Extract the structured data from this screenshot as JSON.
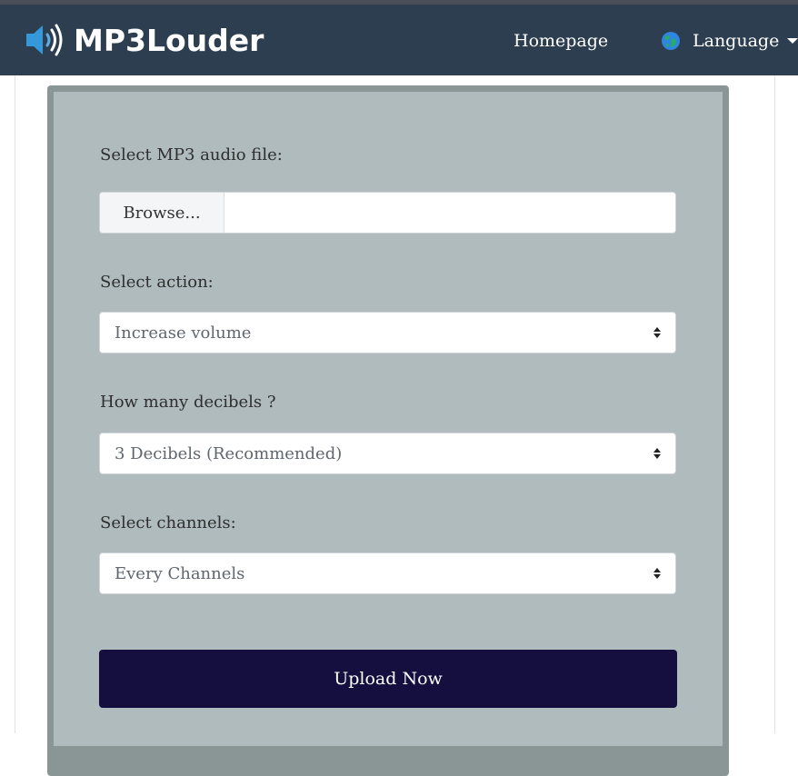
{
  "header": {
    "brand_name": "MP3Louder",
    "brand_icon": "speaker-volume-icon",
    "nav": {
      "homepage": "Homepage",
      "language": "Language"
    },
    "colors": {
      "navbar_bg": "#2c3e50",
      "brand_icon": "#3498db"
    }
  },
  "form": {
    "file": {
      "label": "Select MP3 audio file:",
      "browse_label": "Browse..."
    },
    "action": {
      "label": "Select action:",
      "selected": "Increase volume"
    },
    "decibels": {
      "label": "How many decibels ?",
      "selected": "3 Decibels (Recommended)"
    },
    "channels": {
      "label": "Select channels:",
      "selected": "Every Channels"
    },
    "submit_label": "Upload Now",
    "colors": {
      "panel_border": "#8a9596",
      "panel_bg": "#b0bbbd",
      "submit_bg": "#140f3f"
    }
  }
}
